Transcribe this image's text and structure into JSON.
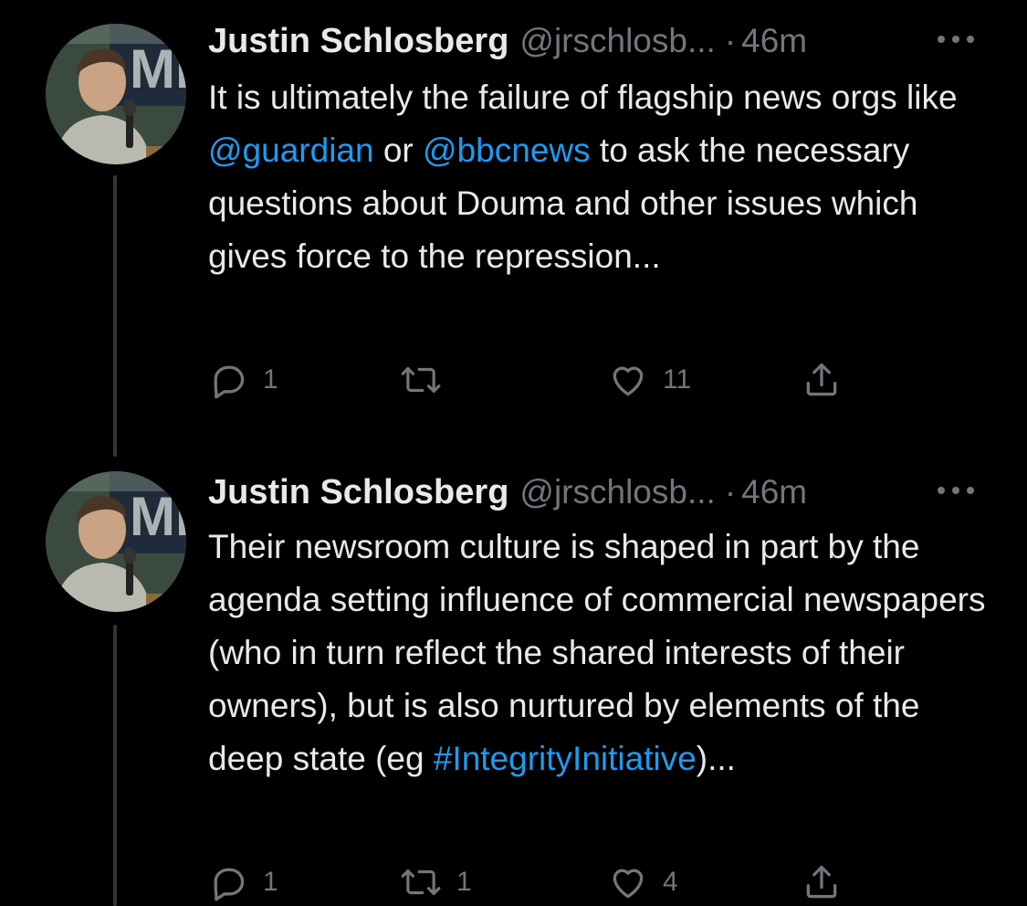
{
  "tweets": [
    {
      "author_name": "Justin Schlosberg",
      "handle": "@jrschlosb...",
      "separator": "·",
      "time": "46m",
      "more_icon": "more-horizontal-icon",
      "text_parts": {
        "p1": "It is ultimately the failure of flagship news orgs like ",
        "mention1": "@guardian",
        "p2": " or ",
        "mention2": "@bbcnews",
        "p3": " to ask the necessary questions about Douma and other issues which gives force to the repression..."
      },
      "reply_count": "1",
      "retweet_count": "",
      "like_count": "11"
    },
    {
      "author_name": "Justin Schlosberg",
      "handle": "@jrschlosb...",
      "separator": "·",
      "time": "46m",
      "more_icon": "more-horizontal-icon",
      "text_parts": {
        "p1": "Their newsroom culture is shaped in part by the agenda setting influence of commercial newspapers (who in turn reflect the shared interests of their owners), but is also nurtured by elements of the deep state (eg ",
        "hashtag": "#IntegrityInitiative",
        "p2": ")..."
      },
      "reply_count": "1",
      "retweet_count": "1",
      "like_count": "4"
    }
  ],
  "colors": {
    "background": "#000000",
    "text": "#e7e9ea",
    "secondary": "#71767b",
    "link": "#1d9bf0",
    "thread_line": "#333639"
  },
  "icons": {
    "reply": "reply-bubble-icon",
    "retweet": "retweet-icon",
    "like": "heart-icon",
    "share": "share-icon"
  }
}
